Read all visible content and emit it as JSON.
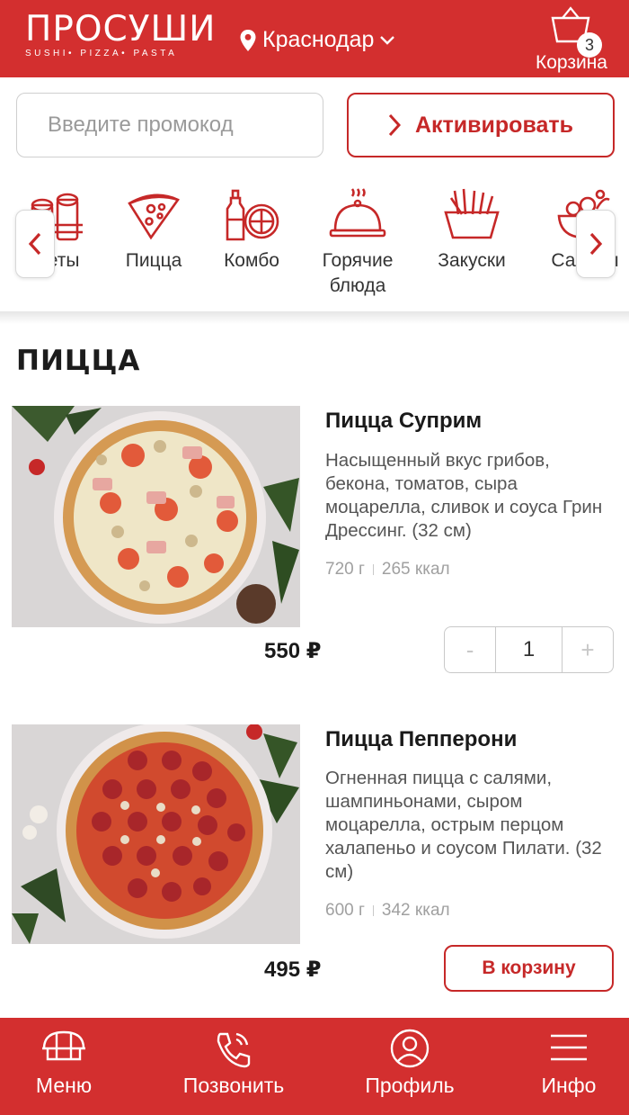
{
  "header": {
    "logo": "ПРОСУШИ",
    "logo_sub": "SUSHI• PIZZA• PASTA",
    "city": "Краснодар",
    "cart_count": "3",
    "cart_label": "Корзина"
  },
  "promo": {
    "placeholder": "Введите промокод",
    "button_label": "Активировать"
  },
  "categories": [
    {
      "label": "Сеты",
      "icon": "rolls-icon"
    },
    {
      "label": "Пицца",
      "icon": "pizza-slice-icon"
    },
    {
      "label": "Комбо",
      "icon": "combo-icon"
    },
    {
      "label": "Горячие блюда",
      "icon": "cloche-icon"
    },
    {
      "label": "Закуски",
      "icon": "fries-icon"
    },
    {
      "label": "Салаты",
      "icon": "salad-icon"
    }
  ],
  "section": {
    "title": "ПИЦЦА"
  },
  "products": [
    {
      "name": "Пицца Суприм",
      "description": "Насыщенный вкус грибов, бекона, томатов, сыра моцарелла, сливок и соуса Грин Дрессинг. (32 см)",
      "weight": "720 г",
      "calories": "265 ккал",
      "price": "550 ₽",
      "quantity": "1",
      "minus": "-",
      "plus": "+"
    },
    {
      "name": "Пицца Пепперони",
      "description": "Огненная пицца с салями, шампиньонами, сыром моцарелла, острым перцом халапеньо и соусом Пилати. (32 см)",
      "weight": "600 г",
      "calories": "342 ккал",
      "price": "495 ₽",
      "cart_button": "В корзину"
    }
  ],
  "bottom_nav": [
    {
      "label": "Меню",
      "icon": "menu-icon"
    },
    {
      "label": "Позвонить",
      "icon": "phone-icon"
    },
    {
      "label": "Профиль",
      "icon": "profile-icon"
    },
    {
      "label": "Инфо",
      "icon": "hamburger-icon"
    }
  ],
  "colors": {
    "brand": "#d32f2f",
    "accent": "#c62828"
  }
}
